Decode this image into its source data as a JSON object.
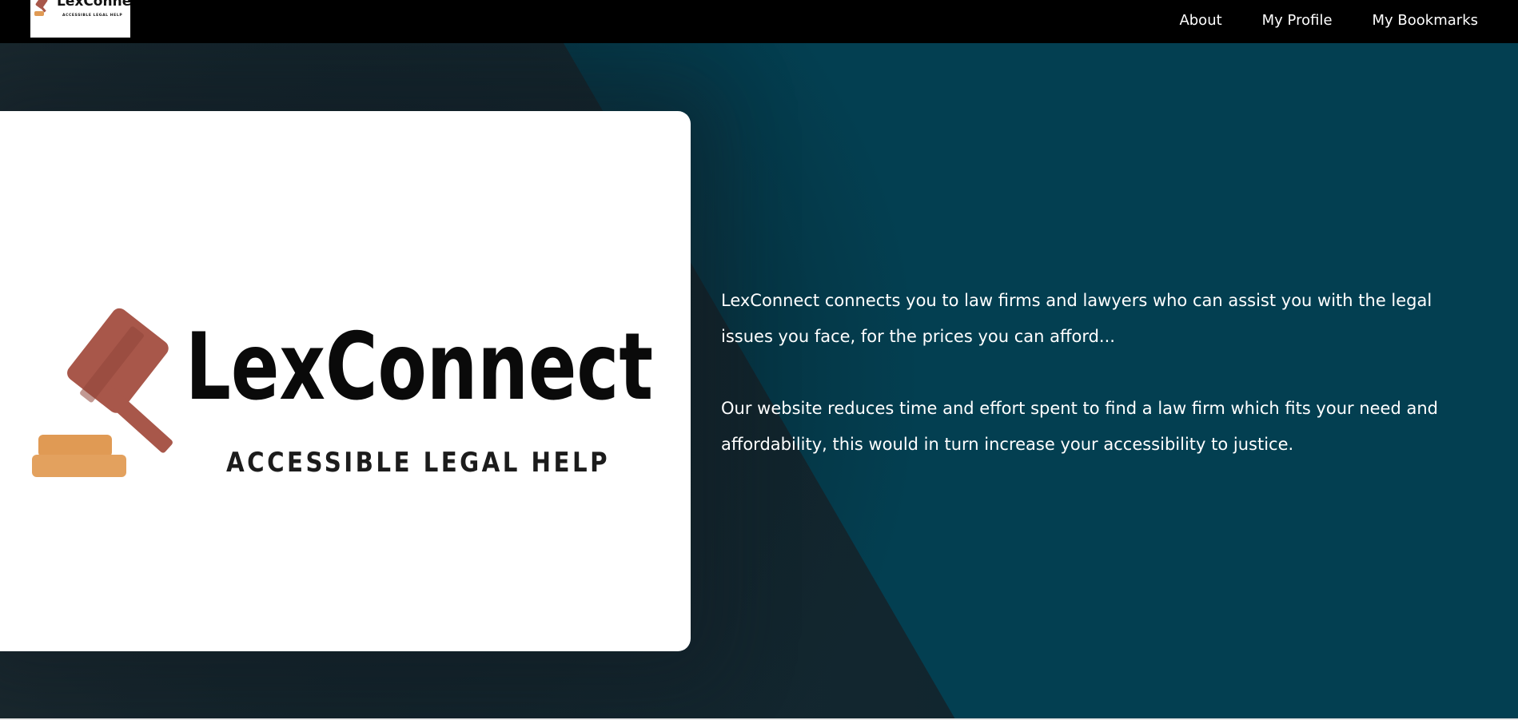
{
  "brand": {
    "name": "LexConnect",
    "tagline": "ACCESSIBLE LEGAL HELP"
  },
  "nav": {
    "items": [
      {
        "label": "About"
      },
      {
        "label": "My Profile"
      },
      {
        "label": "My Bookmarks"
      }
    ]
  },
  "hero": {
    "paragraph_1": "LexConnect connects you to law firms and lawyers who can assist you with the legal issues you face, for the prices you can afford...",
    "paragraph_2": "Our website reduces time and effort spent to find a law firm which fits your need and affordability, this would in turn increase your accessibility to justice."
  },
  "colors": {
    "nav_bg": "#000000",
    "hero_bg": "#033f51",
    "hero_dark": "#1a2a30",
    "gavel": "#a8574a",
    "gavel_base": "#e09a54",
    "text": "#ffffff"
  },
  "icons": {
    "logo_mark": "gavel-icon"
  }
}
